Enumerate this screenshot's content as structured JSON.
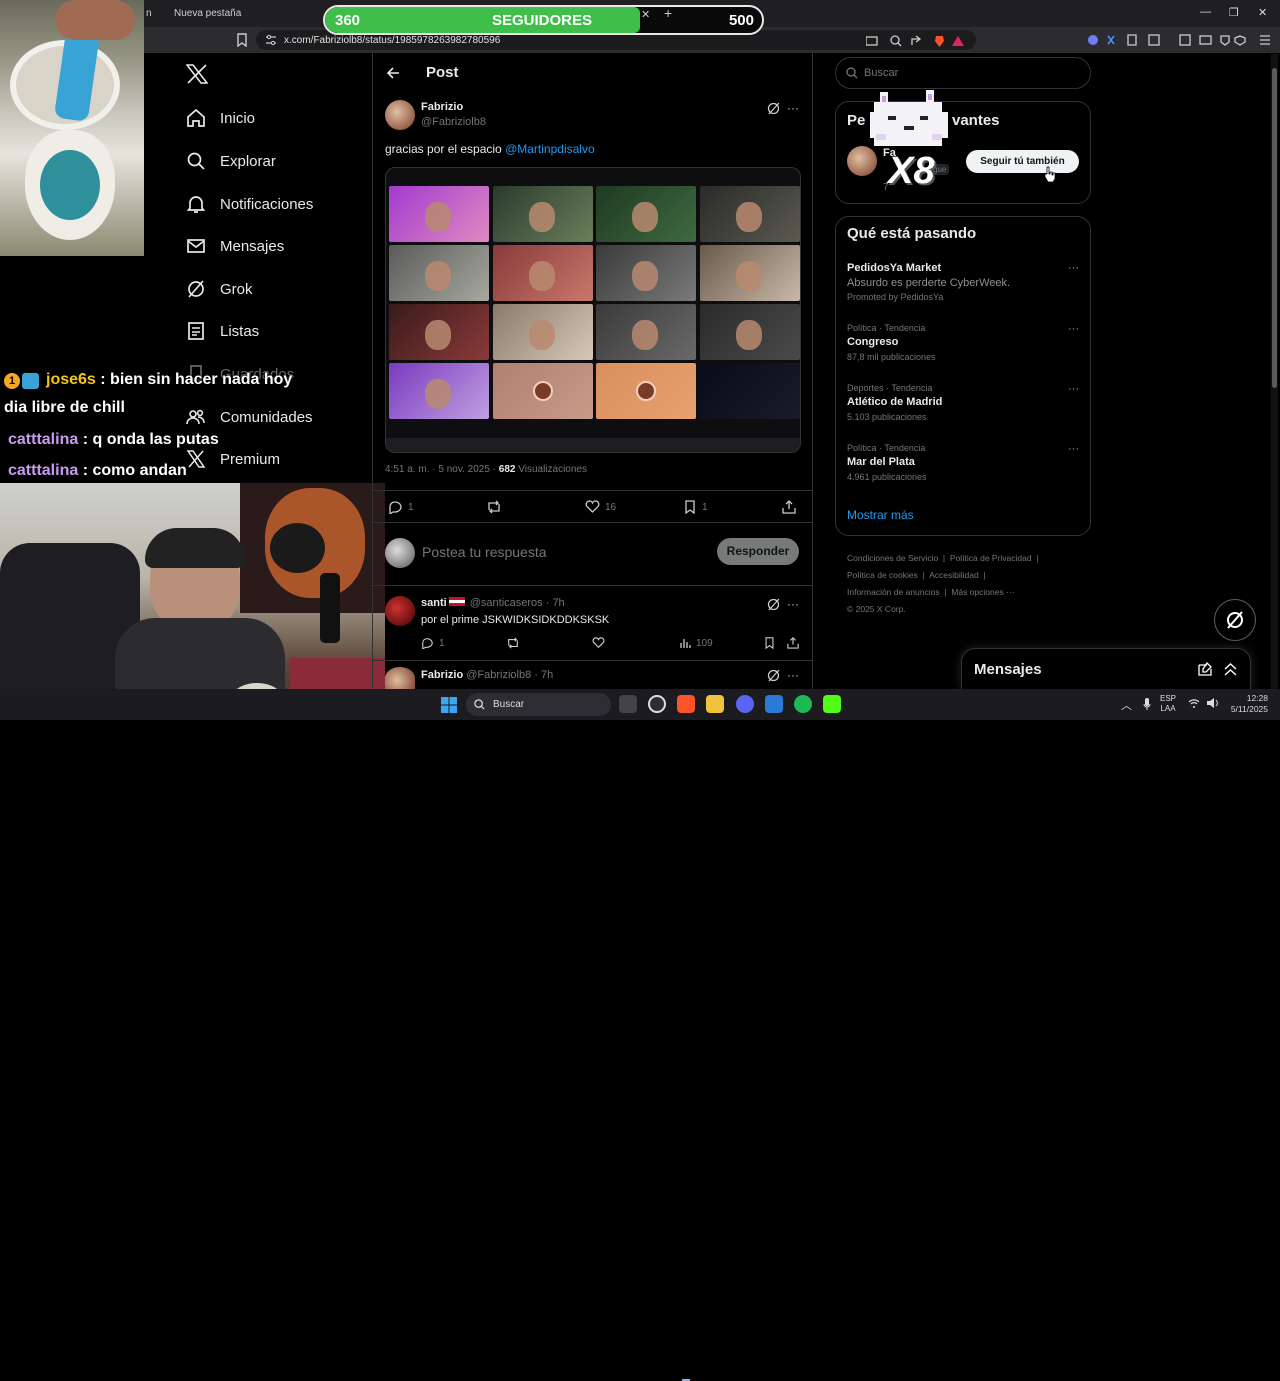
{
  "browser": {
    "tab_left": "n",
    "tab_new": "Nueva pestaña",
    "url": "x.com/Fabriziolb8/status/1985978263982780596"
  },
  "overlay": {
    "followers_current": "360",
    "followers_label": "SEGUIDORES",
    "followers_goal": "500",
    "followers_progress": 0.72,
    "cat_multiplier": "X8",
    "chat": [
      {
        "user": "jose6s",
        "message": ": bien sin hacer nada hoy",
        "cont": "dia libre de chill",
        "color": "#f5c518"
      },
      {
        "user": "catttalina",
        "message": ": q onda las putas",
        "color": "#c79cf0"
      },
      {
        "user": "catttalina",
        "message": ": como andan",
        "color": "#c79cf0"
      }
    ]
  },
  "sidebar": {
    "items": [
      {
        "label": "Inicio",
        "icon": "home-icon"
      },
      {
        "label": "Explorar",
        "icon": "search-icon"
      },
      {
        "label": "Notificaciones",
        "icon": "bell-icon"
      },
      {
        "label": "Mensajes",
        "icon": "mail-icon"
      },
      {
        "label": "Grok",
        "icon": "grok-icon"
      },
      {
        "label": "Listas",
        "icon": "list-icon"
      },
      {
        "label": "Guardados",
        "icon": "bookmark-icon"
      },
      {
        "label": "Comunidades",
        "icon": "people-icon"
      },
      {
        "label": "Premium",
        "icon": "x-icon"
      }
    ]
  },
  "post": {
    "header": "Post",
    "author_name": "Fabrizio",
    "author_handle": "@Fabriziolb8",
    "text": "gracias por el espacio ",
    "mention": "@Martinpdisalvo",
    "time": "4:51 a. m. · 5 nov. 2025 · ",
    "views_count": "682",
    "views_label": " Visualizaciones",
    "replies": "1",
    "likes": "16",
    "bookmarks": "1",
    "reply_placeholder": "Postea tu respuesta",
    "reply_button": "Responder"
  },
  "replies": [
    {
      "name": "santi",
      "handle": "@santicaseros · 7h",
      "text": "por el prime JSKWIDKSIDKDDKSKSK",
      "replies": "1",
      "views": "109"
    },
    {
      "name": "Fabrizio",
      "handle": "@Fabriziolb8 · 7h"
    }
  ],
  "right": {
    "search_placeholder": "Buscar",
    "relevant_title_a": "Pe",
    "relevant_title_b": "vantes",
    "relevant_user_name": "Fa",
    "relevant_user_sub": "gue",
    "relevant_user_extra": "7",
    "follow_button": "Seguir tú también",
    "trends_title": "Qué está pasando",
    "trends": [
      {
        "meta": "",
        "name": "PedidosYa Market",
        "desc": "Absurdo es perderte CyberWeek.",
        "promo": "Promoted by PedidosYa"
      },
      {
        "meta": "Política · Tendencia",
        "name": "Congreso",
        "count": "87,8 mil publicaciones"
      },
      {
        "meta": "Deportes · Tendencia",
        "name": "Atlético de Madrid",
        "count": "5.103 publicaciones"
      },
      {
        "meta": "Política · Tendencia",
        "name": "Mar del Plata",
        "count": "4.961 publicaciones"
      }
    ],
    "show_more": "Mostrar más",
    "footer": [
      "Condiciones de Servicio",
      "Política de Privacidad",
      "Política de cookies",
      "Accesibilidad",
      "Información de anuncios",
      "Más opciones ···",
      "© 2025 X Corp."
    ],
    "messages_title": "Mensajes"
  },
  "taskbar": {
    "search": "Buscar",
    "lang_a": "ESP",
    "lang_b": "LAA",
    "time": "12:28",
    "date": "5/11/2025"
  },
  "colors": {
    "accent": "#1d9bf0",
    "green": "#3fbf4a"
  }
}
